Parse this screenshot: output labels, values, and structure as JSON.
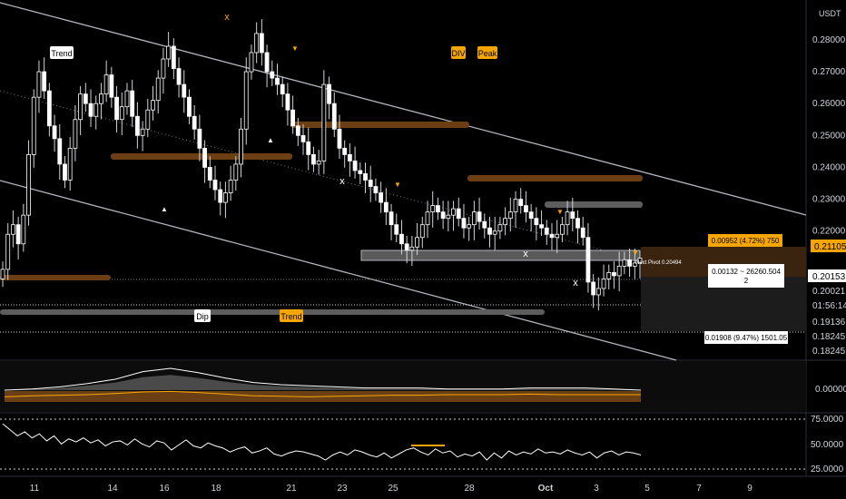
{
  "chart_data": [
    {
      "type": "candlestick",
      "panel": "price",
      "currency": "USDT",
      "y_ticks": [
        "0.28000",
        "0.27000",
        "0.26000",
        "0.25000",
        "0.24000",
        "0.23000",
        "0.22000"
      ],
      "ylim": [
        0.1795,
        0.2925
      ],
      "x_ticks": [
        "11",
        "14",
        "16",
        "18",
        "21",
        "23",
        "25",
        "28",
        "Oct",
        "3",
        "5",
        "7",
        "9"
      ],
      "x_ticks_bold": "Oct",
      "candle_close_series": [
        0.208,
        0.219,
        0.222,
        0.216,
        0.225,
        0.244,
        0.262,
        0.27,
        0.264,
        0.253,
        0.249,
        0.241,
        0.236,
        0.246,
        0.255,
        0.263,
        0.26,
        0.256,
        0.26,
        0.263,
        0.269,
        0.262,
        0.255,
        0.259,
        0.264,
        0.256,
        0.25,
        0.252,
        0.258,
        0.261,
        0.268,
        0.274,
        0.278,
        0.271,
        0.266,
        0.262,
        0.256,
        0.252,
        0.246,
        0.24,
        0.236,
        0.233,
        0.229,
        0.232,
        0.236,
        0.241,
        0.252,
        0.27,
        0.276,
        0.282,
        0.276,
        0.27,
        0.268,
        0.266,
        0.263,
        0.258,
        0.253,
        0.25,
        0.248,
        0.244,
        0.241,
        0.242,
        0.266,
        0.26,
        0.252,
        0.246,
        0.244,
        0.242,
        0.239,
        0.238,
        0.236,
        0.234,
        0.232,
        0.229,
        0.226,
        0.222,
        0.219,
        0.216,
        0.214,
        0.215,
        0.218,
        0.222,
        0.226,
        0.228,
        0.226,
        0.224,
        0.225,
        0.227,
        0.224,
        0.221,
        0.222,
        0.226,
        0.223,
        0.221,
        0.219,
        0.22,
        0.222,
        0.224,
        0.226,
        0.23,
        0.228,
        0.226,
        0.224,
        0.222,
        0.221,
        0.219,
        0.218,
        0.219,
        0.222,
        0.226,
        0.224,
        0.221,
        0.218,
        0.204,
        0.2,
        0.202,
        0.205,
        0.207,
        0.206,
        0.209,
        0.211,
        0.209,
        0.21,
        0.2115
      ],
      "annotations": {
        "labels": [
          "Trend",
          "DIV",
          "Peak",
          "Dip",
          "Trend"
        ],
        "markers": [
          "x",
          "x",
          "x",
          "x",
          "▼",
          "▼",
          "▼",
          "▼",
          "▲",
          "▲"
        ],
        "next_pivot_label": "Next Pivot 0.20494"
      },
      "price_labels": [
        {
          "text": "0.21105",
          "style": "orange"
        },
        {
          "text": "0.20153",
          "style": "gray"
        },
        {
          "text": "0.20021",
          "style": "dark"
        },
        {
          "text": "01:56:14",
          "style": "dark"
        },
        {
          "text": "0.19136",
          "style": "dark"
        },
        {
          "text": "0.18245",
          "style": "dark"
        },
        {
          "text": "0.18245",
          "style": "dark"
        }
      ],
      "info_boxes": {
        "upper": "0.00952 (4.72%) 750",
        "middle_line1": "0.00132 ~ 26260.504",
        "middle_line2": "2",
        "lower": "0.01908 (9.47%) 1501.05"
      }
    },
    {
      "type": "area",
      "panel": "oscillator",
      "y_ticks": [
        "0.00000"
      ],
      "series": [
        {
          "values": [
            0.0,
            0.05,
            0.15,
            0.3,
            0.5,
            0.85,
            1.0,
            0.8,
            0.55,
            0.35,
            0.25,
            0.2,
            0.15,
            0.1,
            0.1,
            0.1,
            0.05,
            0.05,
            0.05,
            0.1,
            0.1,
            0.1,
            0.05,
            0.0
          ]
        },
        {
          "values": [
            -0.2,
            -0.1,
            -0.05,
            0.0,
            0.1,
            0.25,
            0.3,
            0.2,
            0.05,
            -0.1,
            -0.15,
            -0.2,
            -0.15,
            -0.1,
            -0.05,
            -0.05,
            0.0,
            0.0,
            0.0,
            0.05,
            0.0,
            0.0,
            0.0,
            0.0
          ]
        }
      ]
    },
    {
      "type": "line",
      "panel": "rsi",
      "y_ticks": [
        "75.0000",
        "50.0000",
        "25.0000"
      ],
      "ylim": [
        18,
        82
      ],
      "values": [
        72,
        66,
        60,
        64,
        58,
        62,
        55,
        60,
        52,
        57,
        54,
        58,
        53,
        56,
        50,
        54,
        55,
        51,
        57,
        52,
        49,
        55,
        53,
        46,
        51,
        56,
        50,
        48,
        53,
        50,
        48,
        44,
        47,
        49,
        43,
        45,
        48,
        42,
        40,
        43,
        45,
        44,
        42,
        40,
        36,
        41,
        44,
        41,
        46,
        44,
        41,
        39,
        43,
        38,
        42,
        46,
        48,
        44,
        41,
        47,
        43,
        45,
        39,
        42,
        40,
        44,
        36,
        43,
        38,
        45,
        41,
        44,
        42,
        47,
        43,
        44,
        42,
        46,
        43,
        41,
        44,
        38,
        43,
        45,
        41,
        44,
        43,
        41
      ]
    }
  ]
}
